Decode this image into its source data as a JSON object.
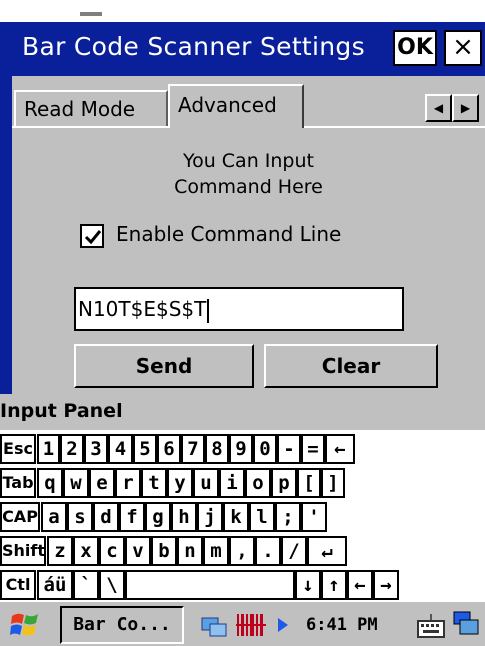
{
  "dialog": {
    "title": "Bar Code Scanner Settings",
    "ok_label": "OK",
    "close_label": "×",
    "tabs": [
      {
        "label": "Read Mode",
        "selected": false
      },
      {
        "label": "Advanced",
        "selected": true
      }
    ],
    "tab_scroll_left": "◀",
    "tab_scroll_right": "▶",
    "hint_line1": "You Can Input",
    "hint_line2": "Command Here",
    "enable_label": "Enable Command Line",
    "enable_checked": true,
    "command_value": "N10T$E$S$T",
    "send_label": "Send",
    "clear_label": "Clear"
  },
  "input_panel": {
    "title": "Input Panel",
    "rows": [
      [
        "Esc",
        "1",
        "2",
        "3",
        "4",
        "5",
        "6",
        "7",
        "8",
        "9",
        "0",
        "-",
        "=",
        "←"
      ],
      [
        "Tab",
        "q",
        "w",
        "e",
        "r",
        "t",
        "y",
        "u",
        "i",
        "o",
        "p",
        "[",
        "]"
      ],
      [
        "CAP",
        "a",
        "s",
        "d",
        "f",
        "g",
        "h",
        "j",
        "k",
        "l",
        ";",
        "'"
      ],
      [
        "Shift",
        "z",
        "x",
        "c",
        "v",
        "b",
        "n",
        "m",
        ",",
        ".",
        "/",
        "↵"
      ],
      [
        "Ctl",
        "áü",
        "`",
        "\\",
        "",
        "↓",
        "↑",
        "←",
        "→"
      ]
    ]
  },
  "taskbar": {
    "start_icon": "windows-flag-icon",
    "task_label": "Bar Co...",
    "clock": "6:41 PM",
    "tray_icons": [
      "network-icon",
      "barcode-icon",
      "arrow-icon",
      "keyboard-icon",
      "desktop-icon"
    ]
  },
  "colors": {
    "title_bar": "#0a1f9a",
    "dialog_bg": "#c0c0c0",
    "keyboard_bg": "#ffffff"
  }
}
